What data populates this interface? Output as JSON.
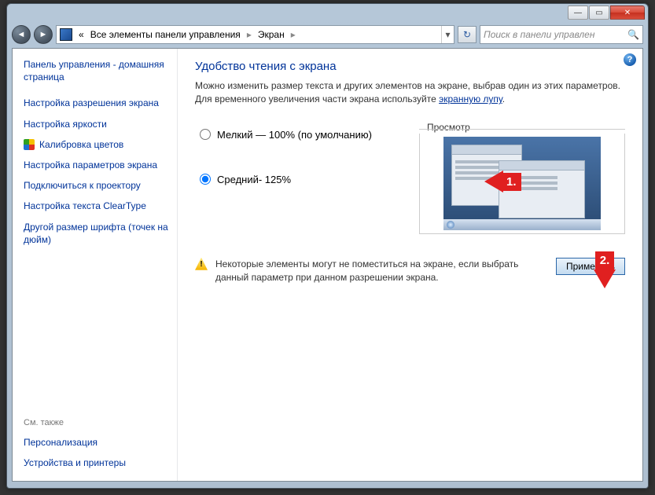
{
  "window": {
    "minimize": "—",
    "maximize": "▭",
    "close": "✕"
  },
  "nav": {
    "back": "◄",
    "forward": "►",
    "refresh": "↻"
  },
  "breadcrumb": {
    "overflow": "«",
    "item1": "Все элементы панели управления",
    "item2": "Экран",
    "sep": "▸",
    "dropdown": "▾"
  },
  "search": {
    "placeholder": "Поиск в панели управлен",
    "icon": "🔍"
  },
  "help": "?",
  "sidebar": {
    "home": "Панель управления - домашняя страница",
    "links": [
      "Настройка разрешения экрана",
      "Настройка яркости",
      "Калибровка цветов",
      "Настройка параметров экрана",
      "Подключиться к проектору",
      "Настройка текста ClearType",
      "Другой размер шрифта (точек на дюйм)"
    ],
    "see_also": "См. также",
    "related": [
      "Персонализация",
      "Устройства и принтеры"
    ]
  },
  "main": {
    "heading": "Удобство чтения с экрана",
    "desc_pre": "Можно изменить размер текста и других элементов на экране, выбрав один из этих параметров. Для временного увеличения части экрана используйте ",
    "desc_link": "экранную лупу",
    "desc_post": ".",
    "option_small": "Мелкий — 100% (по умолчанию)",
    "option_medium": "Средний- 125%",
    "preview_label": "Просмотр",
    "warning": "Некоторые элементы могут не поместиться на экране, если выбрать данный параметр при данном разрешении экрана.",
    "apply": "Применить"
  },
  "callouts": {
    "c1": "1.",
    "c2": "2."
  }
}
